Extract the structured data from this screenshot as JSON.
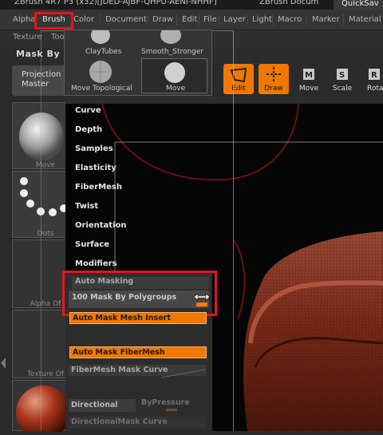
{
  "title_bar": {
    "left_text": "ZBrush 4R7 P3 (x32)[JDED-AJBF-QHPU-AENI-NHHF]",
    "right_text": "ZBrush Docum",
    "quicksave": "QuickSav"
  },
  "menus": [
    "Alpha",
    "Brush",
    "Color",
    "Document",
    "Draw",
    "Edit",
    "File",
    "Layer",
    "Light",
    "Macro",
    "Marker",
    "Material"
  ],
  "row2": {
    "texture": "Texture",
    "tool": "Too"
  },
  "palette_title": "Mask By P",
  "projection_master": {
    "line1": "Projection",
    "line2": "Master"
  },
  "left_thumbs": {
    "brush_label": "Move",
    "stroke_label": "Dots",
    "alpha_label": "Alpha Of",
    "texture_label": "Texture Of"
  },
  "brush_panel": {
    "items": [
      "ClayTubes",
      "Smooth_Stronger",
      "Move Topological",
      "Move"
    ]
  },
  "tools": {
    "edit": "Edit",
    "draw": "Draw",
    "move": "Move",
    "scale": "Scale",
    "rotate": "Rotat",
    "accent_color": "#f07800"
  },
  "brush_menu_items": [
    "Curve",
    "Depth",
    "Samples",
    "Elasticity",
    "FiberMesh",
    "Twist",
    "Orientation",
    "Surface",
    "Modifiers"
  ],
  "auto_masking": {
    "title": "Auto Masking",
    "slider_value": "100",
    "slider_label": "Mask By Polygroups",
    "slider_fraction": 1.0,
    "btn_mesh_insert": "Auto Mask Mesh Insert",
    "btn_fibermesh": "Auto Mask FiberMesh",
    "fibermesh_curve": "FiberMesh Mask Curve",
    "directional": "Directional",
    "by_pressure": "ByPressure",
    "directional_curve": "DirectionalMask Curve"
  },
  "highlight_color": "#e0161d"
}
